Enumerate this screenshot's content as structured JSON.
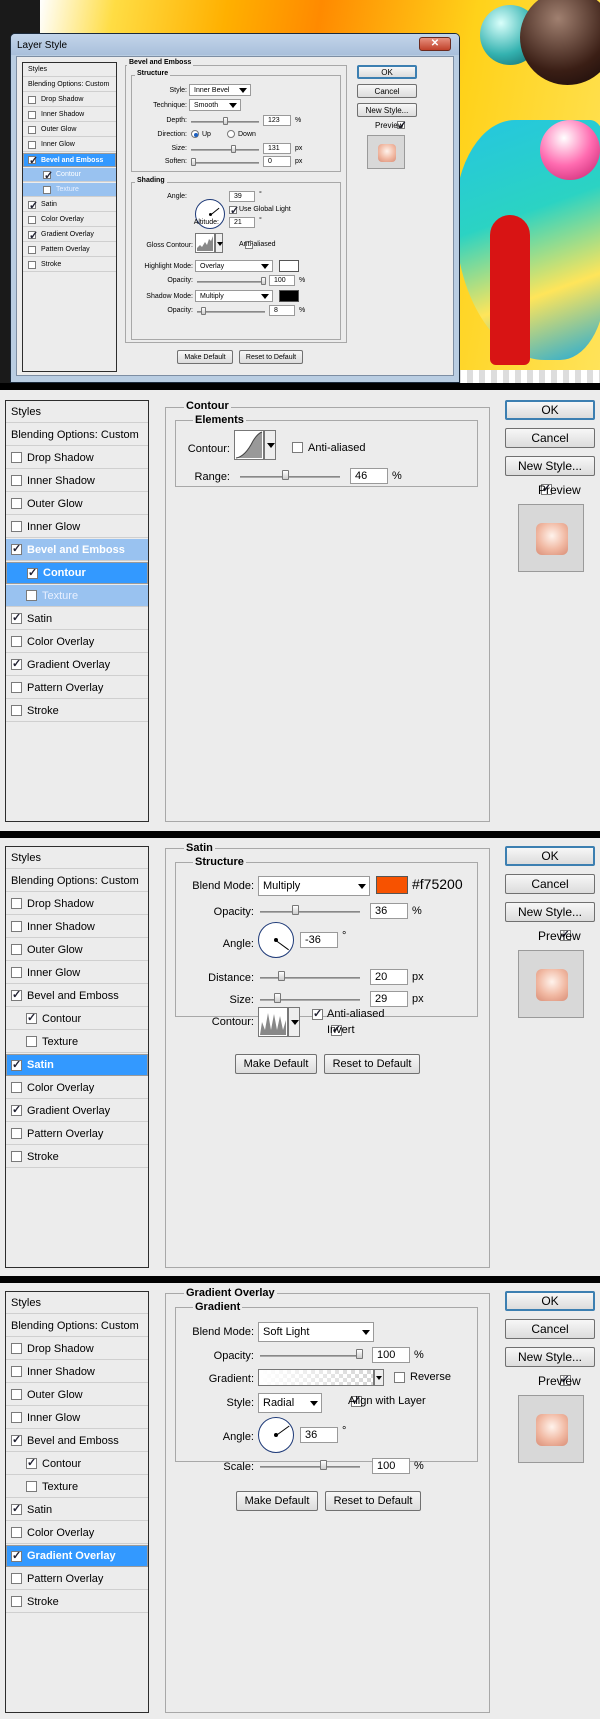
{
  "styles_list": {
    "header": "Styles",
    "blending": "Blending Options: Custom",
    "items": {
      "drop_shadow": "Drop Shadow",
      "inner_shadow": "Inner Shadow",
      "outer_glow": "Outer Glow",
      "inner_glow": "Inner Glow",
      "bevel": "Bevel and Emboss",
      "contour": "Contour",
      "texture": "Texture",
      "satin": "Satin",
      "color_overlay": "Color Overlay",
      "gradient_overlay": "Gradient Overlay",
      "pattern_overlay": "Pattern Overlay",
      "stroke": "Stroke"
    },
    "checked": [
      "bevel",
      "contour",
      "satin",
      "gradient_overlay"
    ]
  },
  "buttons": {
    "ok": "OK",
    "cancel": "Cancel",
    "new_style": "New Style...",
    "preview": "Preview",
    "make_default": "Make Default",
    "reset_default": "Reset to Default"
  },
  "panel1": {
    "window_title": "Layer Style",
    "section": "Bevel and Emboss",
    "structure": "Structure",
    "style_label": "Style:",
    "style_value": "Inner Bevel",
    "technique_label": "Technique:",
    "technique_value": "Smooth",
    "depth_label": "Depth:",
    "depth_value": "123",
    "depth_unit": "%",
    "direction_label": "Direction:",
    "dir_up": "Up",
    "dir_down": "Down",
    "size_label": "Size:",
    "size_value": "131",
    "size_unit": "px",
    "soften_label": "Soften:",
    "soften_value": "0",
    "soften_unit": "px",
    "shading": "Shading",
    "angle_label": "Angle:",
    "angle_value": "39",
    "angle_unit": "°",
    "global_light": "Use Global Light",
    "altitude_label": "Altitude:",
    "altitude_value": "21",
    "altitude_unit": "°",
    "gloss_label": "Gloss Contour:",
    "anti_aliased": "Anti-aliased",
    "hl_mode_label": "Highlight Mode:",
    "hl_mode_value": "Overlay",
    "hl_opacity_label": "Opacity:",
    "hl_opacity_value": "100",
    "hl_opacity_unit": "%",
    "sh_mode_label": "Shadow Mode:",
    "sh_mode_value": "Multiply",
    "sh_opacity_label": "Opacity:",
    "sh_opacity_value": "8",
    "sh_opacity_unit": "%",
    "highlight_color": "#ffffff",
    "shadow_color": "#000000"
  },
  "panel2": {
    "section": "Contour",
    "elements": "Elements",
    "contour_label": "Contour:",
    "anti_aliased": "Anti-aliased",
    "range_label": "Range:",
    "range_value": "46",
    "range_unit": "%"
  },
  "panel3": {
    "section": "Satin",
    "structure": "Structure",
    "blend_label": "Blend Mode:",
    "blend_value": "Multiply",
    "color_hex": "#f75200",
    "color_text": "#f75200",
    "opacity_label": "Opacity:",
    "opacity_value": "36",
    "opacity_unit": "%",
    "angle_label": "Angle:",
    "angle_value": "-36",
    "angle_unit": "°",
    "distance_label": "Distance:",
    "distance_value": "20",
    "distance_unit": "px",
    "size_label": "Size:",
    "size_value": "29",
    "size_unit": "px",
    "contour_label": "Contour:",
    "anti_aliased": "Anti-aliased",
    "invert": "Invert"
  },
  "panel4": {
    "section": "Gradient Overlay",
    "gradient_group": "Gradient",
    "blend_label": "Blend Mode:",
    "blend_value": "Soft Light",
    "opacity_label": "Opacity:",
    "opacity_value": "100",
    "opacity_unit": "%",
    "gradient_label": "Gradient:",
    "reverse": "Reverse",
    "style_label": "Style:",
    "style_value": "Radial",
    "align": "Align with Layer",
    "angle_label": "Angle:",
    "angle_value": "36",
    "angle_unit": "°",
    "scale_label": "Scale:",
    "scale_value": "100",
    "scale_unit": "%"
  }
}
